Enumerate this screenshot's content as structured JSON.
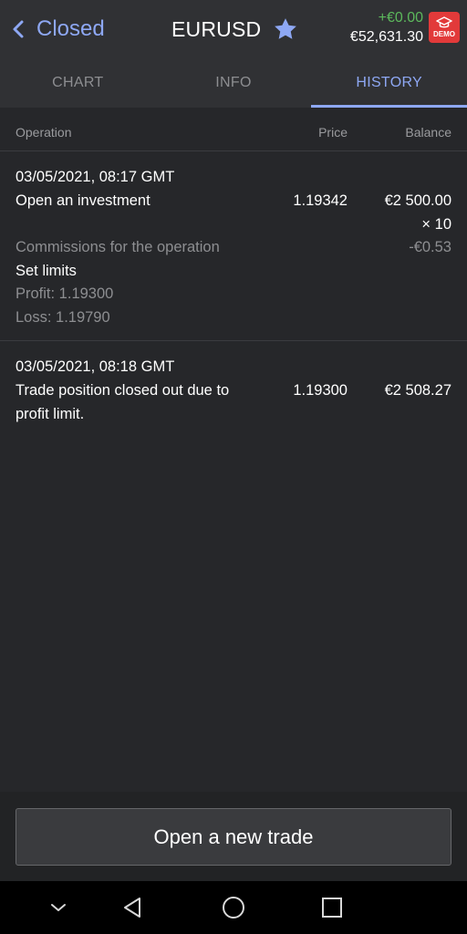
{
  "header": {
    "back_label": "Closed",
    "instrument": "EURUSD",
    "pnl": "+€0.00",
    "balance": "€52,631.30",
    "demo_label": "DEMO"
  },
  "tabs": [
    {
      "label": "CHART",
      "active": false
    },
    {
      "label": "INFO",
      "active": false
    },
    {
      "label": "HISTORY",
      "active": true
    }
  ],
  "columns": {
    "operation": "Operation",
    "price": "Price",
    "balance": "Balance"
  },
  "history": [
    {
      "datetime": "03/05/2021, 08:17 GMT",
      "operation": "Open an investment",
      "price": "1.19342",
      "amount": "€2 500.00",
      "multiplier": "× 10",
      "commission_label": "Commissions for the operation",
      "commission_value": "-€0.53",
      "limits_label": "Set limits",
      "profit": "Profit: 1.19300",
      "loss": "Loss: 1.19790"
    },
    {
      "datetime": "03/05/2021, 08:18 GMT",
      "operation_line1": "Trade position closed out due to",
      "operation_line2": "profit limit.",
      "price": "1.19300",
      "amount": "€2 508.27"
    }
  ],
  "actions": {
    "open_new_trade": "Open a new trade"
  },
  "colors": {
    "accent": "#8ea8f4",
    "positive": "#5cb85c",
    "demo_badge": "#e23a3a",
    "background": "#26272a",
    "bar": "#303134"
  },
  "icons": [
    "chevron-left-icon",
    "star-icon",
    "graduation-cap-icon",
    "nav-collapse-icon",
    "nav-back-icon",
    "nav-home-icon",
    "nav-recents-icon"
  ]
}
